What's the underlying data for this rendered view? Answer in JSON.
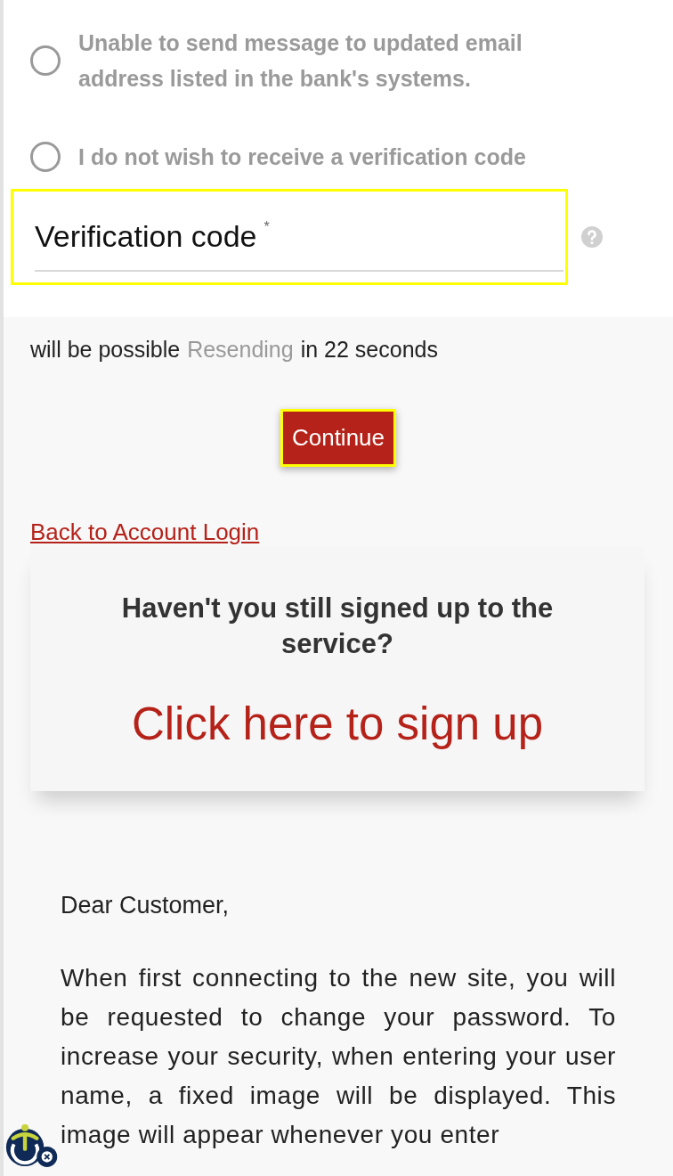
{
  "options": [
    {
      "label": "Unable to send message to updated email address listed in the bank's systems.",
      "selected": false
    },
    {
      "label": "I do not wish to receive a verification code",
      "selected": false
    }
  ],
  "verification_field": {
    "label": "Verification code",
    "required_mark": "*",
    "highlighted": true
  },
  "resend": {
    "prefix": "will be possible",
    "link": "Resending",
    "suffix": "in 22 seconds",
    "disabled": true
  },
  "continue_button": {
    "label": "Continue",
    "highlighted": true
  },
  "back_link": "Back to Account Login",
  "signup_card": {
    "heading": "Haven't you still signed up to the service?",
    "link": "Click here to sign up"
  },
  "message": {
    "greeting": "Dear Customer,",
    "body": "When first connecting to the new site, you will be requested to change your password. To increase your security, when entering your user name, a fixed image will be displayed. This image will appear whenever you enter"
  },
  "accessibility_widget": {
    "visible": true
  }
}
